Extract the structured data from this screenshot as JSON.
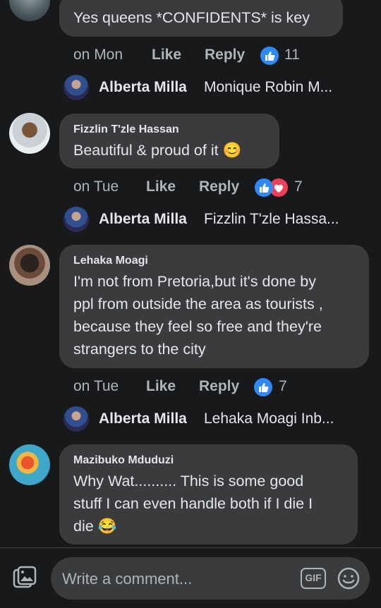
{
  "comments": [
    {
      "text": "Yes queens *CONFIDENTS* is key",
      "time": "on Mon",
      "like_label": "Like",
      "reply_label": "Reply",
      "reaction_count": "11",
      "reply_preview": {
        "name": "Alberta Milla",
        "snippet": "Monique Robin M..."
      }
    },
    {
      "author": "Fizzlin T'zle Hassan",
      "text": "Beautiful & proud of it 😊",
      "time": "on Tue",
      "like_label": "Like",
      "reply_label": "Reply",
      "reaction_count": "7",
      "reply_preview": {
        "name": "Alberta Milla",
        "snippet": "Fizzlin T'zle Hassa..."
      }
    },
    {
      "author": "Lehaka Moagi",
      "text_lines": [
        "I'm not from Pretoria,but it's done by",
        "ppl from outside the area as tourists ,",
        "because they feel so free and they're",
        "strangers to the city"
      ],
      "time": "on Tue",
      "like_label": "Like",
      "reply_label": "Reply",
      "reaction_count": "7",
      "reply_preview": {
        "name": "Alberta Milla",
        "snippet": "Lehaka Moagi Inb..."
      }
    },
    {
      "author": "Mazibuko Mduduzi",
      "text_lines": [
        "Why Wat.......... This is some good",
        "stuff I can even handle both if I die I",
        "die 😂"
      ]
    }
  ],
  "composer": {
    "placeholder": "Write a comment...",
    "gif_label": "GIF"
  },
  "colors": {
    "background": "#18191a",
    "bubble": "#3a3b3c",
    "text": "#e4e6eb",
    "secondary_text": "#b0b3b8",
    "like_blue": "#2e89ff",
    "love_red": "#f33e58"
  }
}
